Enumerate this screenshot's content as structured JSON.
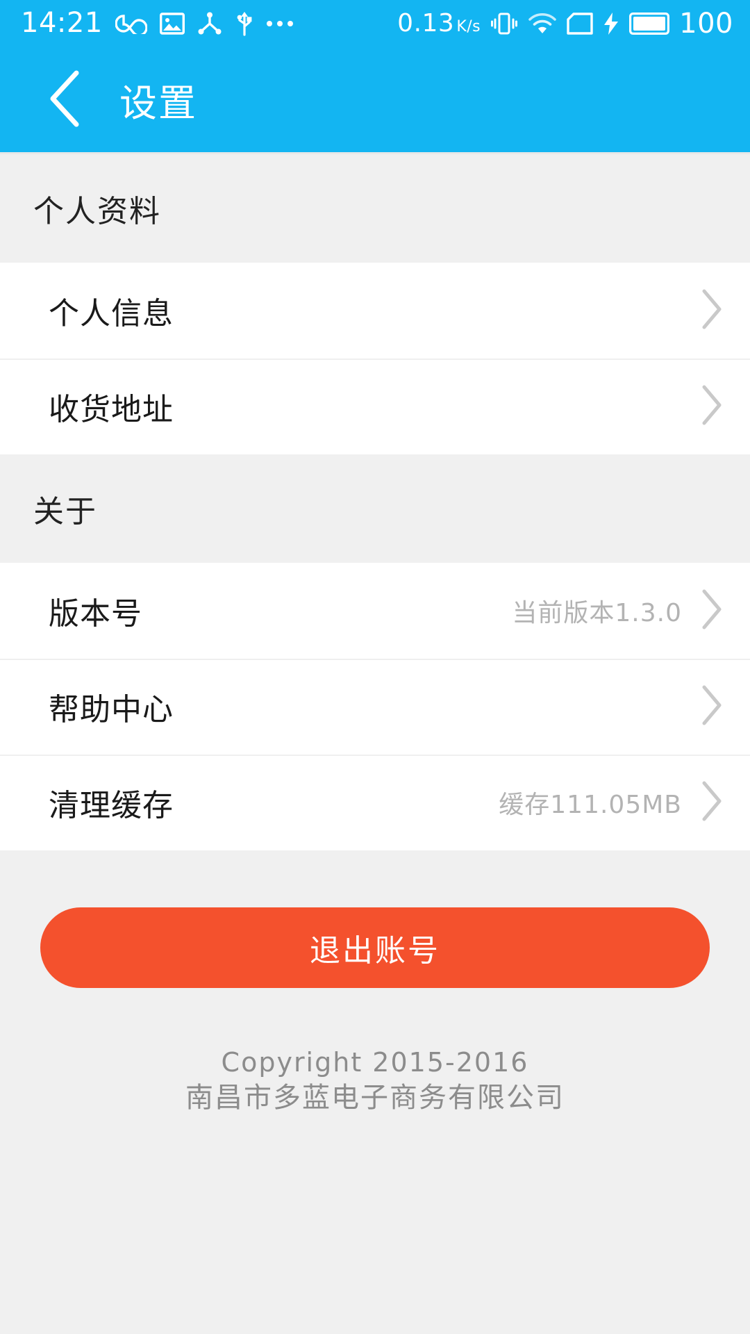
{
  "status_bar": {
    "time": "14:21",
    "network_speed": "0.13",
    "network_unit": "K/s",
    "battery_level": "100",
    "icons": [
      "infinity-icon",
      "image-icon",
      "share-nodes-icon",
      "usb-icon",
      "more-dots-icon",
      "vibrate-icon",
      "wifi-icon",
      "sim-card-icon",
      "charging-bolt-icon",
      "battery-icon"
    ]
  },
  "header": {
    "title": "设置",
    "back_icon": "chevron-left-icon"
  },
  "sections": [
    {
      "title": "个人资料",
      "rows": [
        {
          "label": "个人信息",
          "value": ""
        },
        {
          "label": "收货地址",
          "value": ""
        }
      ]
    },
    {
      "title": "关于",
      "rows": [
        {
          "label": "版本号",
          "value": "当前版本1.3.0"
        },
        {
          "label": "帮助中心",
          "value": ""
        },
        {
          "label": "清理缓存",
          "value": "缓存111.05MB"
        }
      ]
    }
  ],
  "logout": {
    "label": "退出账号"
  },
  "footer": {
    "copyright": "Copyright 2015-2016",
    "company": "南昌市多蓝电子商务有限公司"
  },
  "colors": {
    "accent_blue": "#13b5f2",
    "danger_red": "#f4512d",
    "page_bg": "#f0f0f0",
    "card_bg": "#ffffff",
    "muted_text": "#b3b3b3",
    "chevron": "#c9c9c9"
  }
}
